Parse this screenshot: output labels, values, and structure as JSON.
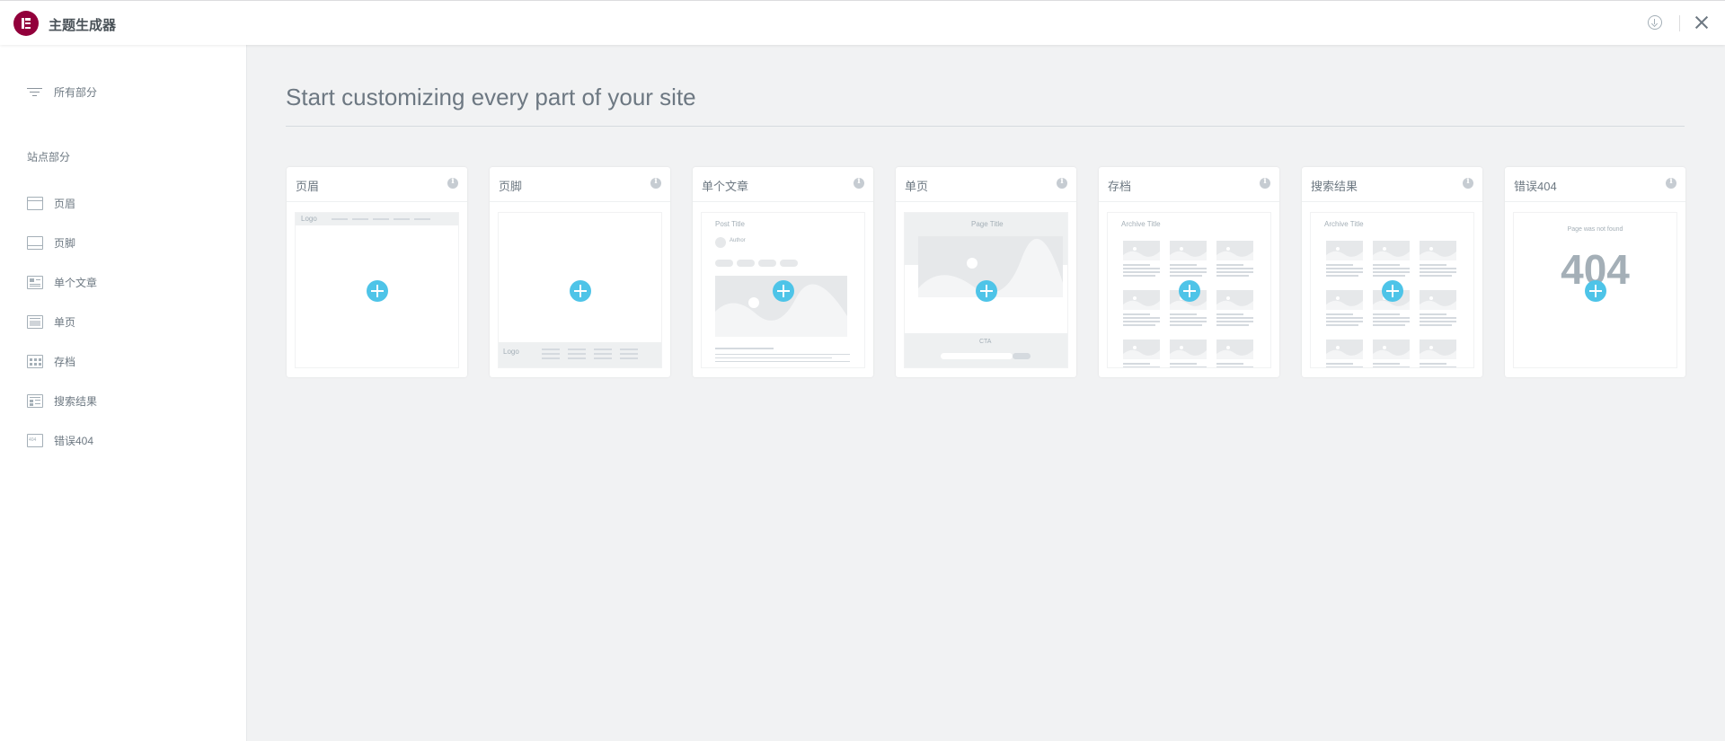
{
  "app": {
    "title": "主题生成器"
  },
  "sidebar": {
    "all_parts": "所有部分",
    "section_title": "站点部分",
    "items": [
      {
        "label": "页眉",
        "icon": "header-icon"
      },
      {
        "label": "页脚",
        "icon": "footer-icon"
      },
      {
        "label": "单个文章",
        "icon": "single-post-icon"
      },
      {
        "label": "单页",
        "icon": "single-page-icon"
      },
      {
        "label": "存档",
        "icon": "archive-icon"
      },
      {
        "label": "搜索结果",
        "icon": "search-results-icon"
      },
      {
        "label": "错误404",
        "icon": "error-404-icon"
      }
    ]
  },
  "main": {
    "title": "Start customizing every part of your site",
    "cards": [
      {
        "title": "页眉",
        "preview": {
          "logo": "Logo"
        }
      },
      {
        "title": "页脚",
        "preview": {
          "logo": "Logo"
        }
      },
      {
        "title": "单个文章",
        "preview": {
          "post_title": "Post Title",
          "author": "Author"
        }
      },
      {
        "title": "单页",
        "preview": {
          "page_title": "Page Title",
          "cta": "CTA"
        }
      },
      {
        "title": "存档",
        "preview": {
          "archive_title": "Archive Title"
        }
      },
      {
        "title": "搜索结果",
        "preview": {
          "archive_title": "Archive Title"
        }
      },
      {
        "title": "错误404",
        "preview": {
          "not_found": "Page was not found",
          "code": "404"
        }
      }
    ]
  },
  "colors": {
    "brand": "#92003b",
    "accent": "#4ec4e8",
    "text": "#6d7882",
    "background": "#f1f2f3"
  }
}
